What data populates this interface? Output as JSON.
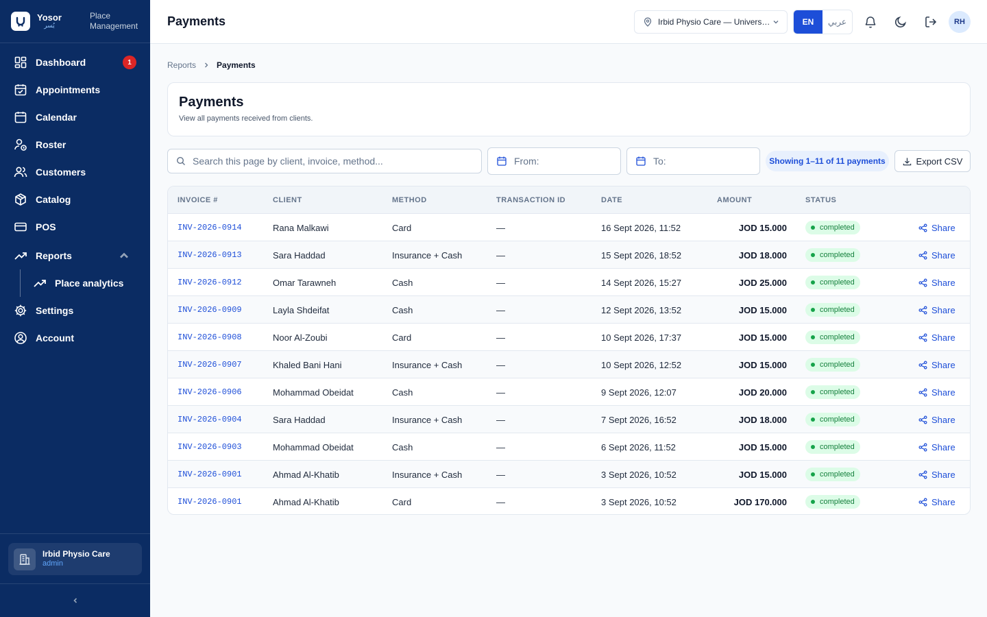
{
  "brand": {
    "name": "Yosor",
    "name_ar": "يُسر",
    "subtitle": "Place Management"
  },
  "sidebar": {
    "items": [
      {
        "label": "Dashboard",
        "badge": "1"
      },
      {
        "label": "Appointments"
      },
      {
        "label": "Calendar"
      },
      {
        "label": "Roster"
      },
      {
        "label": "Customers"
      },
      {
        "label": "Catalog"
      },
      {
        "label": "POS"
      },
      {
        "label": "Reports"
      },
      {
        "label": "Place analytics"
      },
      {
        "label": "Settings"
      },
      {
        "label": "Account"
      }
    ],
    "place": {
      "name": "Irbid Physio Care",
      "role": "admin"
    }
  },
  "header": {
    "title": "Payments",
    "place_selector": "Irbid Physio Care — University Street",
    "lang_en": "EN",
    "lang_ar": "عربي",
    "avatar": "RH"
  },
  "breadcrumb": {
    "parent": "Reports",
    "current": "Payments"
  },
  "page": {
    "title": "Payments",
    "subtitle": "View all payments received from clients."
  },
  "filters": {
    "search_placeholder": "Search this page by client, invoice, method...",
    "from_label": "From:",
    "to_label": "To:",
    "count_text": "Showing 1–11 of 11 payments",
    "export_label": "Export CSV"
  },
  "table": {
    "columns": [
      "INVOICE #",
      "CLIENT",
      "METHOD",
      "TRANSACTION ID",
      "DATE",
      "AMOUNT",
      "STATUS"
    ],
    "share_label": "Share",
    "rows": [
      {
        "invoice": "INV-2026-0914",
        "client": "Rana Malkawi",
        "method": "Card",
        "txn": "—",
        "date": "16 Sept 2026, 11:52",
        "amount": "JOD 15.000",
        "status": "completed"
      },
      {
        "invoice": "INV-2026-0913",
        "client": "Sara Haddad",
        "method": "Insurance + Cash",
        "txn": "—",
        "date": "15 Sept 2026, 18:52",
        "amount": "JOD 18.000",
        "status": "completed"
      },
      {
        "invoice": "INV-2026-0912",
        "client": "Omar Tarawneh",
        "method": "Cash",
        "txn": "—",
        "date": "14 Sept 2026, 15:27",
        "amount": "JOD 25.000",
        "status": "completed"
      },
      {
        "invoice": "INV-2026-0909",
        "client": "Layla Shdeifat",
        "method": "Cash",
        "txn": "—",
        "date": "12 Sept 2026, 13:52",
        "amount": "JOD 15.000",
        "status": "completed"
      },
      {
        "invoice": "INV-2026-0908",
        "client": "Noor Al-Zoubi",
        "method": "Card",
        "txn": "—",
        "date": "10 Sept 2026, 17:37",
        "amount": "JOD 15.000",
        "status": "completed"
      },
      {
        "invoice": "INV-2026-0907",
        "client": "Khaled Bani Hani",
        "method": "Insurance + Cash",
        "txn": "—",
        "date": "10 Sept 2026, 12:52",
        "amount": "JOD 15.000",
        "status": "completed"
      },
      {
        "invoice": "INV-2026-0906",
        "client": "Mohammad Obeidat",
        "method": "Cash",
        "txn": "—",
        "date": "9 Sept 2026, 12:07",
        "amount": "JOD 20.000",
        "status": "completed"
      },
      {
        "invoice": "INV-2026-0904",
        "client": "Sara Haddad",
        "method": "Insurance + Cash",
        "txn": "—",
        "date": "7 Sept 2026, 16:52",
        "amount": "JOD 18.000",
        "status": "completed"
      },
      {
        "invoice": "INV-2026-0903",
        "client": "Mohammad Obeidat",
        "method": "Cash",
        "txn": "—",
        "date": "6 Sept 2026, 11:52",
        "amount": "JOD 15.000",
        "status": "completed"
      },
      {
        "invoice": "INV-2026-0901",
        "client": "Ahmad Al-Khatib",
        "method": "Insurance + Cash",
        "txn": "—",
        "date": "3 Sept 2026, 10:52",
        "amount": "JOD 15.000",
        "status": "completed"
      },
      {
        "invoice": "INV-2026-0901",
        "client": "Ahmad Al-Khatib",
        "method": "Card",
        "txn": "—",
        "date": "3 Sept 2026, 10:52",
        "amount": "JOD 170.000",
        "status": "completed"
      }
    ]
  },
  "colors": {
    "sidebar": "#0b2c63",
    "accent": "#1d4ed8",
    "badge": "#dc2626",
    "success": "#15803d"
  }
}
